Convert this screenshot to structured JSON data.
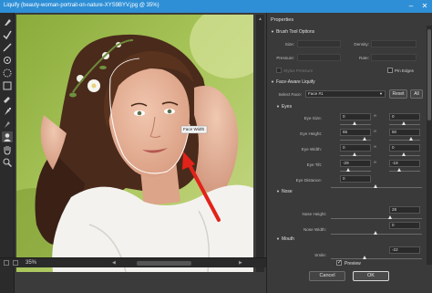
{
  "window": {
    "title": "Liquify (beauty-woman-portrait-on-nature-XYS9BYV.jpg @ 35%)"
  },
  "canvas": {
    "tooltip": "Face Width",
    "zoom": "35%"
  },
  "panel": {
    "title": "Properties",
    "brush_section": "Brush Tool Options",
    "brush": {
      "size_label": "Size:",
      "density_label": "Density:",
      "pressure_label": "Pressure:",
      "rate_label": "Rate:",
      "stylus_label": "Stylus Pressure",
      "pin_edges_label": "Pin Edges"
    },
    "face_section": "Face-Aware Liquify",
    "select_face_label": "Select Face:",
    "select_face_value": "Face #1",
    "reset_label": "Reset",
    "all_label": "All",
    "eyes_section": "Eyes",
    "eyes": [
      {
        "label": "Eye Size:",
        "left": "0",
        "right": "0"
      },
      {
        "label": "Eye Height:",
        "left": "65",
        "right": "50"
      },
      {
        "label": "Eye Width:",
        "left": "0",
        "right": "0"
      },
      {
        "label": "Eye Tilt:",
        "left": "-29",
        "right": "-18"
      }
    ],
    "eye_distance_label": "Eye Distance:",
    "eye_distance": "0",
    "nose_section": "Nose",
    "nose_height_label": "Nose Height:",
    "nose_height": "28",
    "nose_width_label": "Nose Width:",
    "nose_width": "0",
    "mouth_section": "Mouth",
    "smile_label": "Smile:",
    "smile": "-22",
    "preview_label": "Preview",
    "cancel_label": "Cancel",
    "ok_label": "OK"
  }
}
